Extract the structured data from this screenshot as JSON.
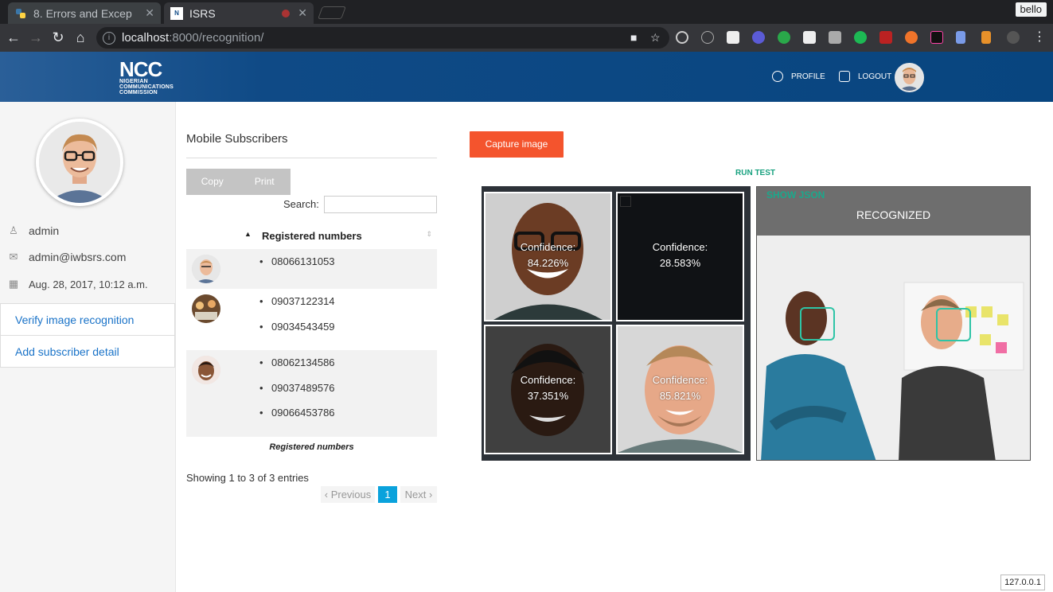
{
  "browser": {
    "tabs": [
      {
        "title": "8. Errors and Excep",
        "active": false
      },
      {
        "title": "ISRS",
        "active": true
      }
    ],
    "profile_name": "bello",
    "url_host": "localhost",
    "url_path": ":8000/recognition/",
    "status_host": "127.0.0.1"
  },
  "header": {
    "logo_text": "NCC",
    "logo_sub": [
      "NIGERIAN",
      "COMMUNICATIONS",
      "COMMISSION"
    ],
    "links": [
      {
        "label": "PROFILE",
        "icon": "user-circle-icon"
      },
      {
        "label": "LOGOUT",
        "icon": "rocket-icon"
      }
    ]
  },
  "sidebar": {
    "username": "admin",
    "email": "admin@iwbsrs.com",
    "joined": "Aug. 28, 2017, 10:12 a.m.",
    "links": [
      "Verify image recognition",
      "Add subscriber detail"
    ]
  },
  "subscribers": {
    "title": "Mobile Subscribers",
    "buttons": [
      "Copy",
      "Print"
    ],
    "search_label": "Search:",
    "search_value": "",
    "column_header": "Registered numbers",
    "footer_label": "Registered numbers",
    "rows": [
      {
        "numbers": [
          "08066131053"
        ]
      },
      {
        "numbers": [
          "09037122314",
          "09034543459"
        ]
      },
      {
        "numbers": [
          "08062134586",
          "09037489576",
          "09066453786"
        ]
      }
    ],
    "info": "Showing 1 to 3 of 3 entries",
    "pagination": {
      "prev": "Previous",
      "current": "1",
      "next": "Next"
    }
  },
  "recognition": {
    "capture_label": "Capture image",
    "run_test_label": "RUN TEST",
    "confidence_label": "Confidence:",
    "faces": [
      {
        "confidence": "84.226%"
      },
      {
        "confidence": "28.583%"
      },
      {
        "confidence": "37.351%"
      },
      {
        "confidence": "85.821%"
      }
    ],
    "show_json_label": "SHOW JSON",
    "result_label": "RECOGNIZED"
  },
  "colors": {
    "header_blue": "#0f4a86",
    "capture_orange": "#f4542d",
    "accent_teal": "#17a17f",
    "pager_blue": "#0aa2dc",
    "link_blue": "#1a73c8"
  }
}
